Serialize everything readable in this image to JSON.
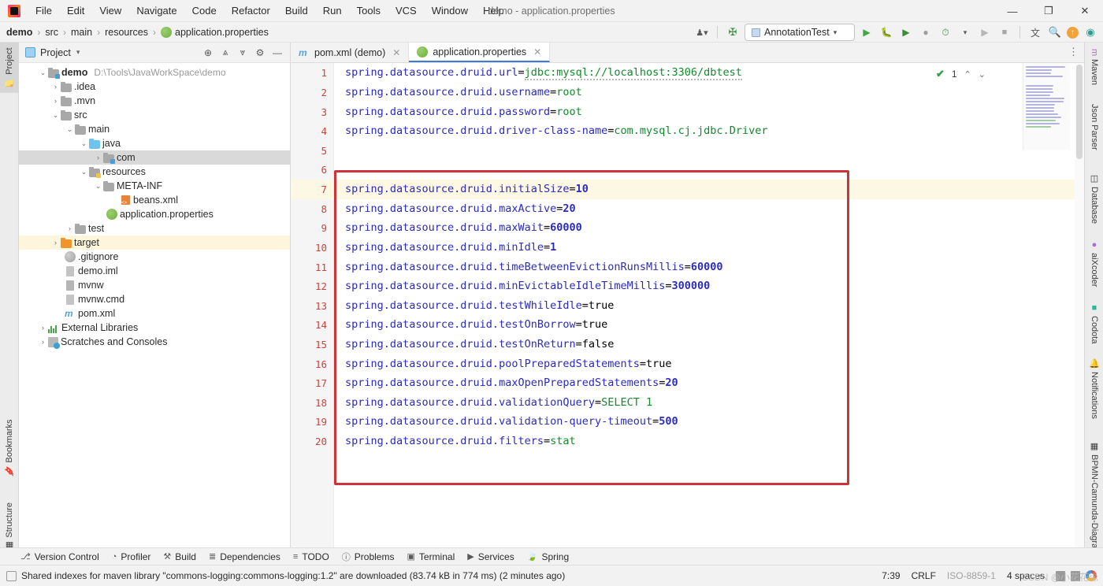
{
  "window": {
    "title": "demo - application.properties",
    "logo_icon": "intellij-idea-logo",
    "minimize_label": "—",
    "maximize_label": "❐",
    "close_label": "✕"
  },
  "menubar": {
    "items": [
      {
        "label": "File"
      },
      {
        "label": "Edit"
      },
      {
        "label": "View"
      },
      {
        "label": "Navigate"
      },
      {
        "label": "Code"
      },
      {
        "label": "Refactor"
      },
      {
        "label": "Build"
      },
      {
        "label": "Run"
      },
      {
        "label": "Tools"
      },
      {
        "label": "VCS"
      },
      {
        "label": "Window"
      },
      {
        "label": "Help"
      }
    ]
  },
  "navbar": {
    "breadcrumbs": [
      {
        "label": "demo",
        "bold": true
      },
      {
        "label": "src",
        "bold": false
      },
      {
        "label": "main",
        "bold": false
      },
      {
        "label": "resources",
        "bold": false
      },
      {
        "label": "application.properties",
        "bold": false,
        "icon": "properties-file-icon"
      }
    ],
    "separator": "›",
    "run_config": "AnnotationTest",
    "run_config_caret": "▾",
    "icons": [
      {
        "name": "user-settings-icon",
        "glyph": "⛏"
      },
      {
        "name": "hammer-build-icon",
        "glyph": "⚒"
      },
      {
        "name": "run-icon",
        "glyph": "▶"
      },
      {
        "name": "debug-icon",
        "glyph": "🐞"
      },
      {
        "name": "run-with-coverage-icon",
        "glyph": "▶"
      },
      {
        "name": "profiler-icon",
        "glyph": "●"
      },
      {
        "name": "run-dashboard-icon",
        "glyph": "⏱"
      },
      {
        "name": "rerun-icon",
        "glyph": "▶"
      },
      {
        "name": "stop-icon",
        "glyph": "■"
      },
      {
        "name": "translate-icon",
        "glyph": "文"
      },
      {
        "name": "search-everywhere-icon",
        "glyph": "🔍"
      },
      {
        "name": "update-icon",
        "glyph": "↑"
      },
      {
        "name": "ide-assistant-icon",
        "glyph": "◖"
      }
    ]
  },
  "left_tool_strip": {
    "top": [
      {
        "label": "Project",
        "icon": "project-folder-icon",
        "selected": true
      }
    ],
    "bottom": [
      {
        "label": "Bookmarks",
        "icon": "bookmark-icon"
      },
      {
        "label": "Structure",
        "icon": "structure-icon"
      }
    ]
  },
  "right_tool_strip": {
    "items": [
      {
        "label": "Maven",
        "icon": "maven-icon"
      },
      {
        "label": "Json Parser",
        "icon": "json-parser-icon"
      },
      {
        "label": "Database",
        "icon": "database-icon"
      },
      {
        "label": "aiXcoder",
        "icon": "aixcoder-icon"
      },
      {
        "label": "Codota",
        "icon": "codota-icon"
      },
      {
        "label": "Notifications",
        "icon": "notifications-icon"
      },
      {
        "label": "BPMN-Camunda-Diagram",
        "icon": "bpmn-diagram-icon"
      }
    ]
  },
  "project_panel": {
    "title": "Project",
    "caret": "▾",
    "tools": [
      {
        "name": "select-opened-file-icon",
        "glyph": "⊕"
      },
      {
        "name": "expand-all-icon",
        "glyph": "⩓"
      },
      {
        "name": "collapse-all-icon",
        "glyph": "⩔"
      },
      {
        "name": "settings-gear-icon",
        "glyph": "⚙"
      },
      {
        "name": "hide-panel-icon",
        "glyph": "—"
      }
    ],
    "tree": [
      {
        "label": "demo",
        "path": "D:\\Tools\\JavaWorkSpace\\demo",
        "depth": 0,
        "arrow": "⌄",
        "icon": "module-folder-icon",
        "bold": true
      },
      {
        "label": ".idea",
        "depth": 1,
        "arrow": "›",
        "icon": "folder-icon"
      },
      {
        "label": ".mvn",
        "depth": 1,
        "arrow": "›",
        "icon": "folder-icon"
      },
      {
        "label": "src",
        "depth": 1,
        "arrow": "⌄",
        "icon": "folder-icon"
      },
      {
        "label": "main",
        "depth": 2,
        "arrow": "⌄",
        "icon": "folder-icon"
      },
      {
        "label": "java",
        "depth": 3,
        "arrow": "⌄",
        "icon": "source-root-icon"
      },
      {
        "label": "com",
        "depth": 4,
        "arrow": "›",
        "icon": "package-folder-icon",
        "state": "selected"
      },
      {
        "label": "resources",
        "depth": 3,
        "arrow": "⌄",
        "icon": "resources-root-icon"
      },
      {
        "label": "META-INF",
        "depth": 4,
        "arrow": "⌄",
        "icon": "folder-icon"
      },
      {
        "label": "beans.xml",
        "depth": 5,
        "arrow": "",
        "icon": "xml-file-icon"
      },
      {
        "label": "application.properties",
        "depth": 4,
        "arrow": "",
        "icon": "properties-file-icon"
      },
      {
        "label": "test",
        "depth": 2,
        "arrow": "›",
        "icon": "folder-icon"
      },
      {
        "label": "target",
        "depth": 1,
        "arrow": "›",
        "icon": "excluded-folder-icon",
        "state": "highlight"
      },
      {
        "label": ".gitignore",
        "depth": 2,
        "arrow": "",
        "icon": "gitignore-file-icon"
      },
      {
        "label": "demo.iml",
        "depth": 2,
        "arrow": "",
        "icon": "iml-file-icon"
      },
      {
        "label": "mvnw",
        "depth": 2,
        "arrow": "",
        "icon": "script-file-icon"
      },
      {
        "label": "mvnw.cmd",
        "depth": 2,
        "arrow": "",
        "icon": "cmd-file-icon"
      },
      {
        "label": "pom.xml",
        "depth": 2,
        "arrow": "",
        "icon": "maven-pom-icon"
      },
      {
        "label": "External Libraries",
        "depth": 0,
        "arrow": "›",
        "icon": "external-libraries-icon"
      },
      {
        "label": "Scratches and Consoles",
        "depth": 0,
        "arrow": "›",
        "icon": "scratches-icon"
      }
    ]
  },
  "editor": {
    "tabs": [
      {
        "label": "pom.xml (demo)",
        "icon": "maven-pom-icon",
        "active": false,
        "close": "✕"
      },
      {
        "label": "application.properties",
        "icon": "properties-file-icon",
        "active": true,
        "close": "✕"
      }
    ],
    "kebab": "⋮",
    "inspection": {
      "count": "1",
      "check_glyph": "✔",
      "up_glyph": "⌃",
      "down_glyph": "⌄"
    },
    "lines": [
      {
        "num": "1",
        "key": "spring.datasource.druid.url",
        "eq": "=",
        "val": "jdbc:mysql://localhost:3306/dbtest",
        "vtype": "string",
        "squiggle": true
      },
      {
        "num": "2",
        "key": "spring.datasource.druid.username",
        "eq": "=",
        "val": "root",
        "vtype": "string"
      },
      {
        "num": "3",
        "key": "spring.datasource.druid.password",
        "eq": "=",
        "val": "root",
        "vtype": "string"
      },
      {
        "num": "4",
        "key": "spring.datasource.druid.driver-class-name",
        "eq": "=",
        "val": "com.mysql.cj.jdbc.Driver",
        "vtype": "string"
      },
      {
        "num": "5",
        "key": "",
        "eq": "",
        "val": "",
        "vtype": "empty"
      },
      {
        "num": "6",
        "key": "",
        "eq": "",
        "val": "",
        "vtype": "empty"
      },
      {
        "num": "7",
        "key": "spring.datasource.druid.initialSize",
        "eq": "=",
        "val": "10",
        "vtype": "number",
        "caret": true
      },
      {
        "num": "8",
        "key": "spring.datasource.druid.maxActive",
        "eq": "=",
        "val": "20",
        "vtype": "number"
      },
      {
        "num": "9",
        "key": "spring.datasource.druid.maxWait",
        "eq": "=",
        "val": "60000",
        "vtype": "number"
      },
      {
        "num": "10",
        "key": "spring.datasource.druid.minIdle",
        "eq": "=",
        "val": "1",
        "vtype": "number"
      },
      {
        "num": "11",
        "key": "spring.datasource.druid.timeBetweenEvictionRunsMillis",
        "eq": "=",
        "val": "60000",
        "vtype": "number"
      },
      {
        "num": "12",
        "key": "spring.datasource.druid.minEvictableIdleTimeMillis",
        "eq": "=",
        "val": "300000",
        "vtype": "number"
      },
      {
        "num": "13",
        "key": "spring.datasource.druid.testWhileIdle",
        "eq": "=",
        "val": "true",
        "vtype": "boolean"
      },
      {
        "num": "14",
        "key": "spring.datasource.druid.testOnBorrow",
        "eq": "=",
        "val": "true",
        "vtype": "boolean"
      },
      {
        "num": "15",
        "key": "spring.datasource.druid.testOnReturn",
        "eq": "=",
        "val": "false",
        "vtype": "boolean"
      },
      {
        "num": "16",
        "key": "spring.datasource.druid.poolPreparedStatements",
        "eq": "=",
        "val": "true",
        "vtype": "boolean"
      },
      {
        "num": "17",
        "key": "spring.datasource.druid.maxOpenPreparedStatements",
        "eq": "=",
        "val": "20",
        "vtype": "number"
      },
      {
        "num": "18",
        "key": "spring.datasource.druid.validationQuery",
        "eq": "=",
        "val": "SELECT 1",
        "vtype": "string"
      },
      {
        "num": "19",
        "key": "spring.datasource.druid.validation-query-timeout",
        "eq": "=",
        "val": "500",
        "vtype": "number"
      },
      {
        "num": "20",
        "key": "spring.datasource.druid.filters",
        "eq": "=",
        "val": "stat",
        "vtype": "string"
      }
    ],
    "annotation": {
      "name": "red-highlight-box",
      "color": "#cf3339",
      "first_line": 7,
      "last_line": 20
    }
  },
  "tool_window_bar": {
    "items": [
      {
        "label": "Version Control",
        "icon": "version-control-icon",
        "glyph": "⎇"
      },
      {
        "label": "Profiler",
        "icon": "profiler-icon",
        "glyph": "◔"
      },
      {
        "label": "Build",
        "icon": "build-hammer-icon",
        "glyph": "⚒"
      },
      {
        "label": "Dependencies",
        "icon": "dependencies-icon",
        "glyph": "≣"
      },
      {
        "label": "TODO",
        "icon": "todo-icon",
        "glyph": "≡"
      },
      {
        "label": "Problems",
        "icon": "problems-icon",
        "glyph": "ⓘ"
      },
      {
        "label": "Terminal",
        "icon": "terminal-icon",
        "glyph": "▣"
      },
      {
        "label": "Services",
        "icon": "services-icon",
        "glyph": "▶"
      },
      {
        "label": "Spring",
        "icon": "spring-leaf-icon",
        "glyph": "🍃"
      }
    ]
  },
  "statusbar": {
    "message_icon": "indexing-icon",
    "message": "Shared indexes for maven library \"commons-logging:commons-logging:1.2\" are downloaded (83.74 kB in 774 ms) (2 minutes ago)",
    "caret_position": "7:39",
    "line_separator": "CRLF",
    "encoding": "ISO-8859-1",
    "indent": "4 spaces",
    "watermark": "CSDN @小花花缘"
  },
  "colors": {
    "accent_blue": "#3b7dd8",
    "key_blue": "#2b2bbd",
    "value_green": "#128a2c",
    "line_number_red": "#c9453f",
    "annotation_red": "#cf3339",
    "caret_line_bg": "#fdf8e3",
    "panel_bg": "#f2f2f2"
  }
}
